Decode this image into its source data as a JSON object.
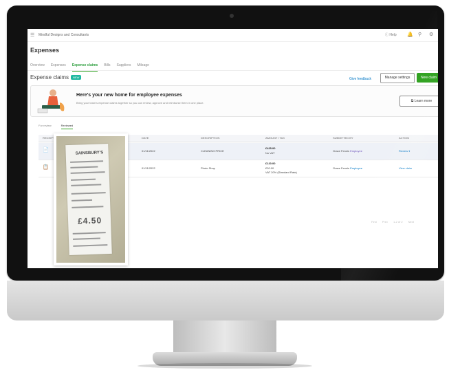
{
  "topbar": {
    "company": "Mindful Designs and Consultants",
    "help_label": "Help",
    "menu_icon": "menu-icon",
    "icons": [
      "help-icon",
      "bell-icon",
      "search-icon",
      "settings-icon"
    ]
  },
  "page": {
    "title": "Expenses"
  },
  "tabs": [
    {
      "label": "Overview",
      "active": false
    },
    {
      "label": "Expenses",
      "active": false
    },
    {
      "label": "Expense claims",
      "active": true
    },
    {
      "label": "Bills",
      "active": false
    },
    {
      "label": "Suppliers",
      "active": false
    },
    {
      "label": "Mileage",
      "active": false
    }
  ],
  "section": {
    "title": "Expense claims",
    "badge": "NEW",
    "feedback": "Give feedback",
    "manage": "Manage settings",
    "new_claim": "New claim"
  },
  "banner": {
    "title": "Here's your new home for employee expenses",
    "subtitle": "Bring your team's expense claims together so you can review, approve and reimburse them in one place.",
    "learn": "Learn more"
  },
  "subtabs": [
    {
      "label": "For review",
      "active": false
    },
    {
      "label": "Reviewed",
      "active": true
    }
  ],
  "table": {
    "columns": [
      "RECEIPT",
      "DATE",
      "DESCRIPTION",
      "AMOUNT / TAX",
      "SUBMITTED BY",
      "ACTION"
    ],
    "rows": [
      {
        "date": "01/11/2022",
        "description": "CLEANING PRICE",
        "amount": "£425.00",
        "tax": "No VAT",
        "tax2": "",
        "submitter": "Grace Fennis",
        "submitter_link": "Employee",
        "action": "Review"
      },
      {
        "date": "01/11/2022",
        "description": "Photo Shop",
        "amount": "£120.00",
        "tax": "£20.00",
        "tax2": "VAT 20% (Standard Rate)",
        "submitter": "Grace Fennis",
        "submitter_link": "Employee",
        "action": "View claim"
      }
    ],
    "pager": [
      "First",
      "Prev",
      "1-2 of 2",
      "Next"
    ]
  },
  "receipt": {
    "store": "SAINSBURY'S",
    "total": "£4.50"
  },
  "colors": {
    "accent_green": "#2ca01c",
    "link_blue": "#0077c5",
    "bezel": "#111111",
    "chin": "#d6d6d6"
  }
}
